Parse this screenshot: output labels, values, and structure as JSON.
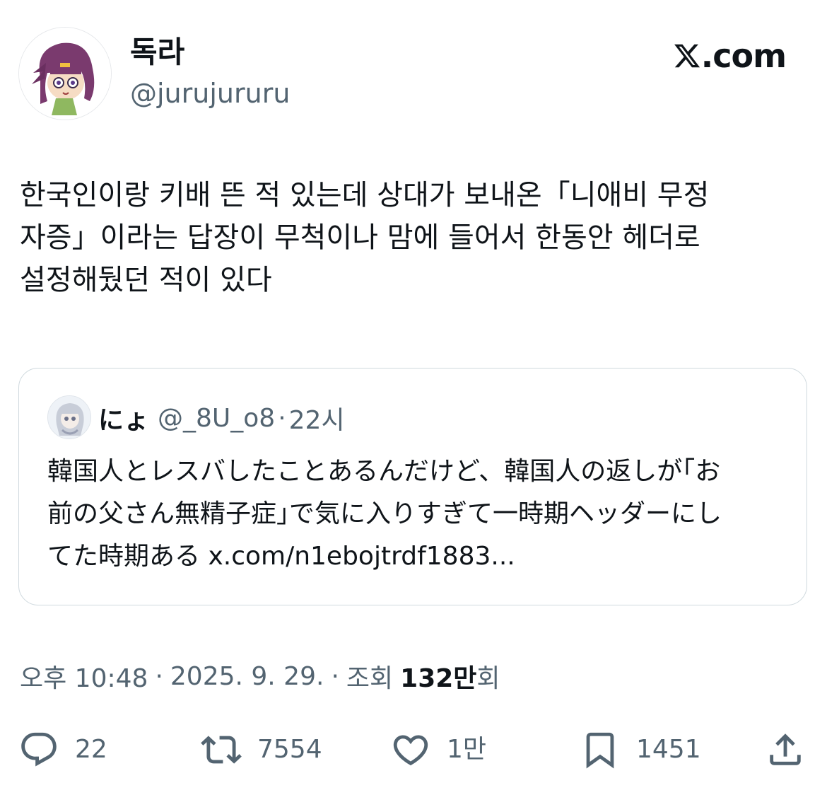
{
  "author": {
    "name": "독라",
    "handle": "@jurujururu",
    "avatar_icon": "anime-girl-avatar-icon"
  },
  "brand": {
    "letter_icon": "x-logo-icon",
    "suffix": ".com"
  },
  "tweet": {
    "text": "한국인이랑 키배 뜬 적 있는데 상대가 보내온「니애비 무정\n자증」이라는 답장이 무척이나 맘에 들어서 한동안 헤더로\n설정해뒀던 적이 있다"
  },
  "quote": {
    "avatar_icon": "anime-avatar-icon",
    "name": "にょ",
    "handle": "@_8U_o8",
    "separator": "·",
    "time": "22시",
    "text": "韓国人とレスバしたことあるんだけど、韓国人の返しが｢お\n前の父さん無精子症｣で気に入りすぎて一時期ヘッダーにし\nてた時期ある x.com/n1ebojtrdf1883..."
  },
  "meta": {
    "time": "오후 10:48",
    "separator": "·",
    "date": "2025. 9. 29.",
    "views_label": "조회",
    "views_count": "132만",
    "views_suffix": "회"
  },
  "actions": {
    "replies": {
      "icon": "reply-icon",
      "count": "22"
    },
    "reposts": {
      "icon": "repost-icon",
      "count": "7554"
    },
    "likes": {
      "icon": "heart-icon",
      "count": "1만"
    },
    "bookmarks": {
      "icon": "bookmark-icon",
      "count": "1451"
    },
    "share": {
      "icon": "share-icon"
    }
  },
  "colors": {
    "text_primary": "#0f1419",
    "text_secondary": "#536471",
    "border": "#cfd9de",
    "background": "#ffffff"
  }
}
